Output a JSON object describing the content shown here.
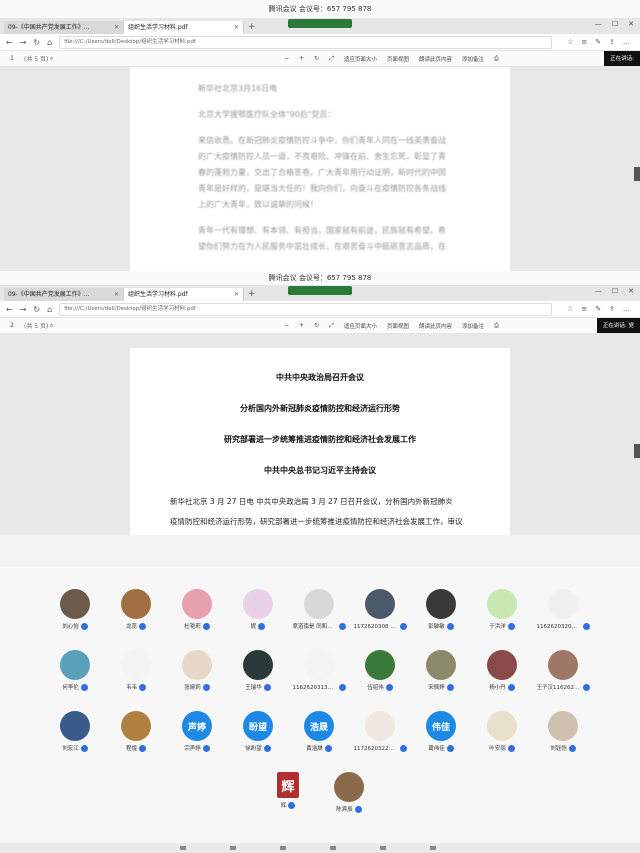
{
  "meeting": {
    "label": "腾讯会议 会议号：657 795 878"
  },
  "browser_top": {
    "tabs": [
      {
        "label": "09-《中国共产党发展工作》..."
      },
      {
        "label": "组织生活学习材料.pdf"
      }
    ],
    "url": "file:///C:/Users/dell/Desktop/组织生活学习材料.pdf",
    "page_number": "1",
    "page_count": "(共 5 页)",
    "tools": [
      "适应页面大小",
      "页面视图",
      "朗读此页内容",
      "添加备注"
    ],
    "speaking": "正在讲话:",
    "doc_lines": [
      "新华社北京3月16日电",
      "北京大学援鄂医疗队全体\"90后\"党员：",
      "来信收悉。在新冠肺炎疫情防控斗争中，你们青年人同在一线英勇奋战",
      "的广大疫情防控人员一道，不畏艰险、冲锋在前、舍生忘死，彰显了青",
      "春的蓬勃力量，交出了合格答卷。广大青年用行动证明，新时代的中国",
      "青年是好样的，是堪当大任的！我向你们，向奋斗在疫情防控各条战线",
      "上的广大青年，致以诚挚的问候！",
      "青年一代有理想、有本领、有担当，国家就有前途，民族就有希望。希",
      "望你们努力在为人民服务中茁壮成长、在艰苦奋斗中砥砺意志品质，在"
    ]
  },
  "browser_bottom": {
    "tabs": [
      {
        "label": "09-《中国共产党发展工作》..."
      },
      {
        "label": "组织生活学习材料.pdf"
      }
    ],
    "url": "file:///C:/Users/dell/Desktop/组织生活学习材料.pdf",
    "page_number": "2",
    "page_count": "(共 5 页)",
    "tools": [
      "适应页面大小",
      "页面视图",
      "朗读此页内容",
      "添加备注"
    ],
    "speaking": "正在讲话: 党",
    "headings": [
      "中共中央政治局召开会议",
      "分析国内外新冠肺炎疫情防控和经济运行形势",
      "研究部署进一步统筹推进疫情防控和经济社会发展工作",
      "中共中央总书记习近平主持会议"
    ],
    "body": [
      "新华社北京 3 月 27 日电  中共中央政治局 3 月 27 日召开会议，分析国内外新冠肺炎",
      "疫情防控和经济运行形势，研究部署进一步统筹推进疫情防控和经济社会发展工作，审议"
    ]
  },
  "participants": [
    {
      "name": "刘心怡",
      "color": "#6b5a4a",
      "glyph": ""
    },
    {
      "name": "龙蕊",
      "color": "#a07040",
      "glyph": ""
    },
    {
      "name": "杜艳莉",
      "color": "#e6a0b0",
      "glyph": ""
    },
    {
      "name": "妮",
      "color": "#e8d0e8",
      "glyph": ""
    },
    {
      "name": "席道南是 同和力...",
      "color": "#d8d8d8",
      "glyph": ""
    },
    {
      "name": "1172620308 杨...",
      "color": "#4a5a6a",
      "glyph": ""
    },
    {
      "name": "彭敏敏",
      "color": "#3a3a3a",
      "glyph": ""
    },
    {
      "name": "于洪洋",
      "color": "#c8e8b0",
      "glyph": ""
    },
    {
      "name": "1162620320南...",
      "color": "#f0f0f0",
      "glyph": ""
    },
    {
      "name": "何李伦",
      "color": "#5aa0b8",
      "glyph": ""
    },
    {
      "name": "韦韦",
      "color": "#f4f4f4",
      "glyph": ""
    },
    {
      "name": "张婉莉",
      "color": "#e8d8c8",
      "glyph": ""
    },
    {
      "name": "王瑞华",
      "color": "#2a3a3a",
      "glyph": ""
    },
    {
      "name": "1162620313孔...",
      "color": "#f4f4f4",
      "glyph": ""
    },
    {
      "name": "伍绍伟",
      "color": "#3a7a3a",
      "glyph": ""
    },
    {
      "name": "宋佩婷",
      "color": "#8a8a6a",
      "glyph": ""
    },
    {
      "name": "杨小丹",
      "color": "#8a4a4a",
      "glyph": ""
    },
    {
      "name": "王子汉1162620...",
      "color": "#a07868",
      "glyph": ""
    },
    {
      "name": "刘宏江",
      "color": "#3a5a8a",
      "glyph": ""
    },
    {
      "name": "程煌",
      "color": "#b08040",
      "glyph": ""
    },
    {
      "name": "宗声婷",
      "color": "#1e88e5",
      "glyph": "声婷"
    },
    {
      "name": "徐盼望",
      "color": "#1e88e5",
      "glyph": "盼望"
    },
    {
      "name": "黄浩晟",
      "color": "#1e88e5",
      "glyph": "浩晟"
    },
    {
      "name": "1172620322杨晶",
      "color": "#f0e8e0",
      "glyph": ""
    },
    {
      "name": "葛伟佳",
      "color": "#1e88e5",
      "glyph": "伟佳"
    },
    {
      "name": "叶安丽",
      "color": "#e8e0c8",
      "glyph": ""
    },
    {
      "name": "刘钰恺",
      "color": "#d0c0b0",
      "glyph": ""
    },
    {
      "name": "辉",
      "color": "#b03030",
      "glyph": "辉"
    },
    {
      "name": "陈宾辰",
      "color": "#8a6a4a",
      "glyph": ""
    }
  ]
}
